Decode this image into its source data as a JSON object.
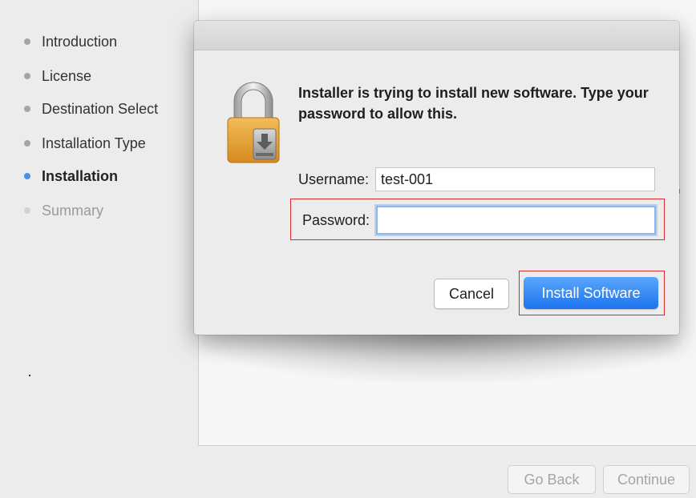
{
  "sidebar": {
    "steps": [
      {
        "label": "Introduction",
        "state": "done"
      },
      {
        "label": "License",
        "state": "done"
      },
      {
        "label": "Destination Select",
        "state": "done"
      },
      {
        "label": "Installation Type",
        "state": "done"
      },
      {
        "label": "Installation",
        "state": "current"
      },
      {
        "label": "Summary",
        "state": "pending"
      }
    ]
  },
  "dialog": {
    "message": "Installer is trying to install new software. Type your password to allow this.",
    "username_label": "Username:",
    "username_value": "test-001",
    "password_label": "Password:",
    "password_value": "",
    "cancel_label": "Cancel",
    "install_label": "Install Software",
    "icon": "lock-installer-icon"
  },
  "footer": {
    "go_back_label": "Go Back",
    "continue_label": "Continue"
  },
  "colors": {
    "accent": "#1c73ee",
    "current_step_dot": "#4a90e2",
    "highlight_box": "#d62a2a",
    "lock_body": "#e9a13a"
  }
}
